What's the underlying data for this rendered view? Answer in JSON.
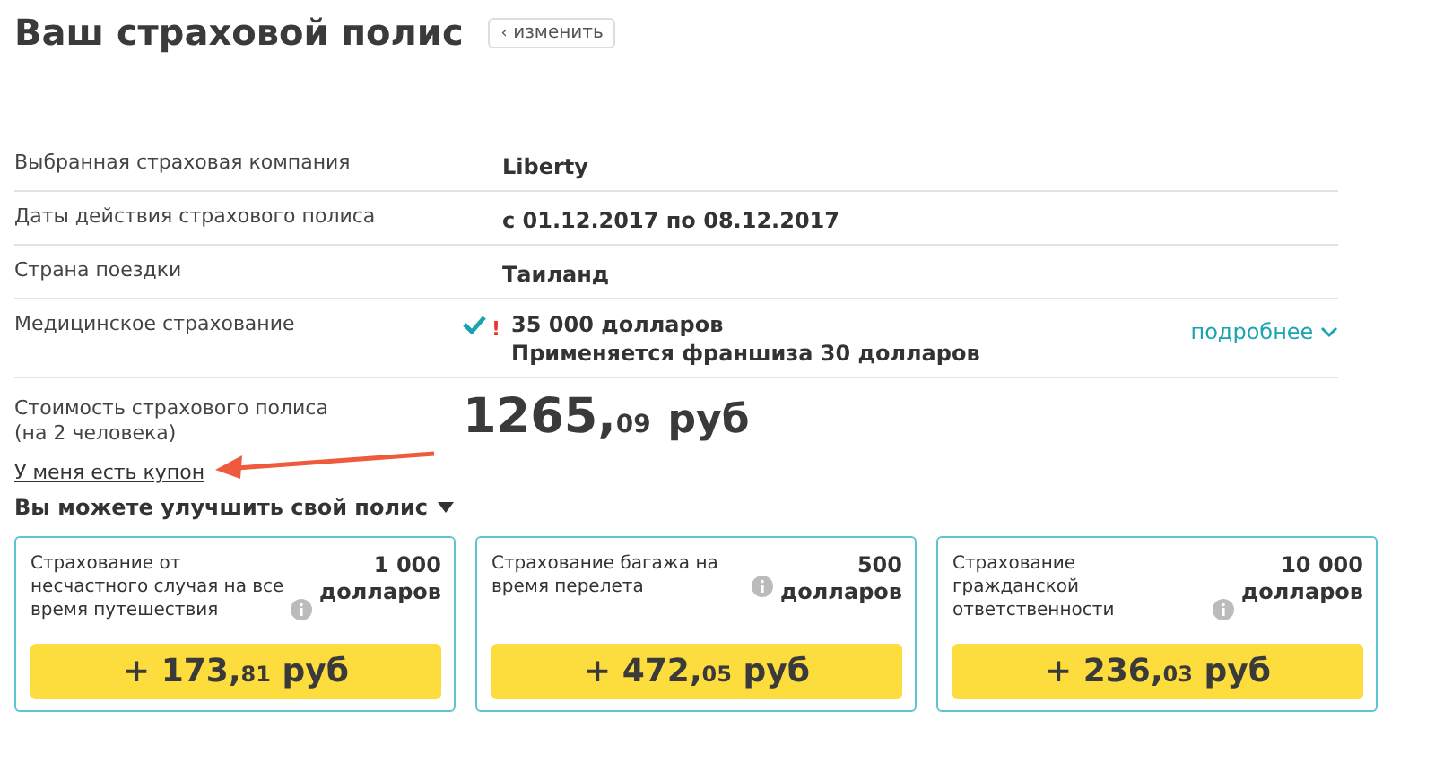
{
  "title": "Ваш страховой полис",
  "change_button": {
    "icon": "‹",
    "label": "изменить"
  },
  "rows": [
    {
      "kind": "plain",
      "label": "Выбранная страховая компания",
      "value": "Liberty"
    },
    {
      "kind": "plain",
      "label": "Даты действия страхового полиса",
      "value": "с 01.12.2017 по 08.12.2017"
    },
    {
      "kind": "plain",
      "label": "Страна поездки",
      "value": "Таиланд"
    },
    {
      "kind": "medical",
      "label": "Медицинское страхование",
      "value": "35 000 долларов",
      "note": "Применяется франшиза 30 долларов",
      "warning": "!",
      "more_link": "подробнее"
    }
  ],
  "cost": {
    "label": [
      "Стоимость страхового полиса",
      "(на 2 человека)"
    ],
    "main": "1265,",
    "cents": "09",
    "unit": "руб"
  },
  "coupon_link": "У меня есть купон",
  "upgrade_heading": "Вы можете улучшить свой полис",
  "options": [
    {
      "title": "Страхование от несчастного случая на все время путешествия",
      "amount": "1 000",
      "amount_unit": "долларов",
      "price": {
        "main": "+ 173,",
        "cents": "81",
        "unit": "руб"
      }
    },
    {
      "title": "Страхование багажа на время перелета",
      "amount": "500",
      "amount_unit": "долларов",
      "price": {
        "main": "+ 472,",
        "cents": "05",
        "unit": "руб"
      }
    },
    {
      "title": "Страхование гражданской ответственности",
      "amount": "10 000",
      "amount_unit": "долларов",
      "price": {
        "main": "+ 236,",
        "cents": "03",
        "unit": "руб"
      }
    }
  ]
}
